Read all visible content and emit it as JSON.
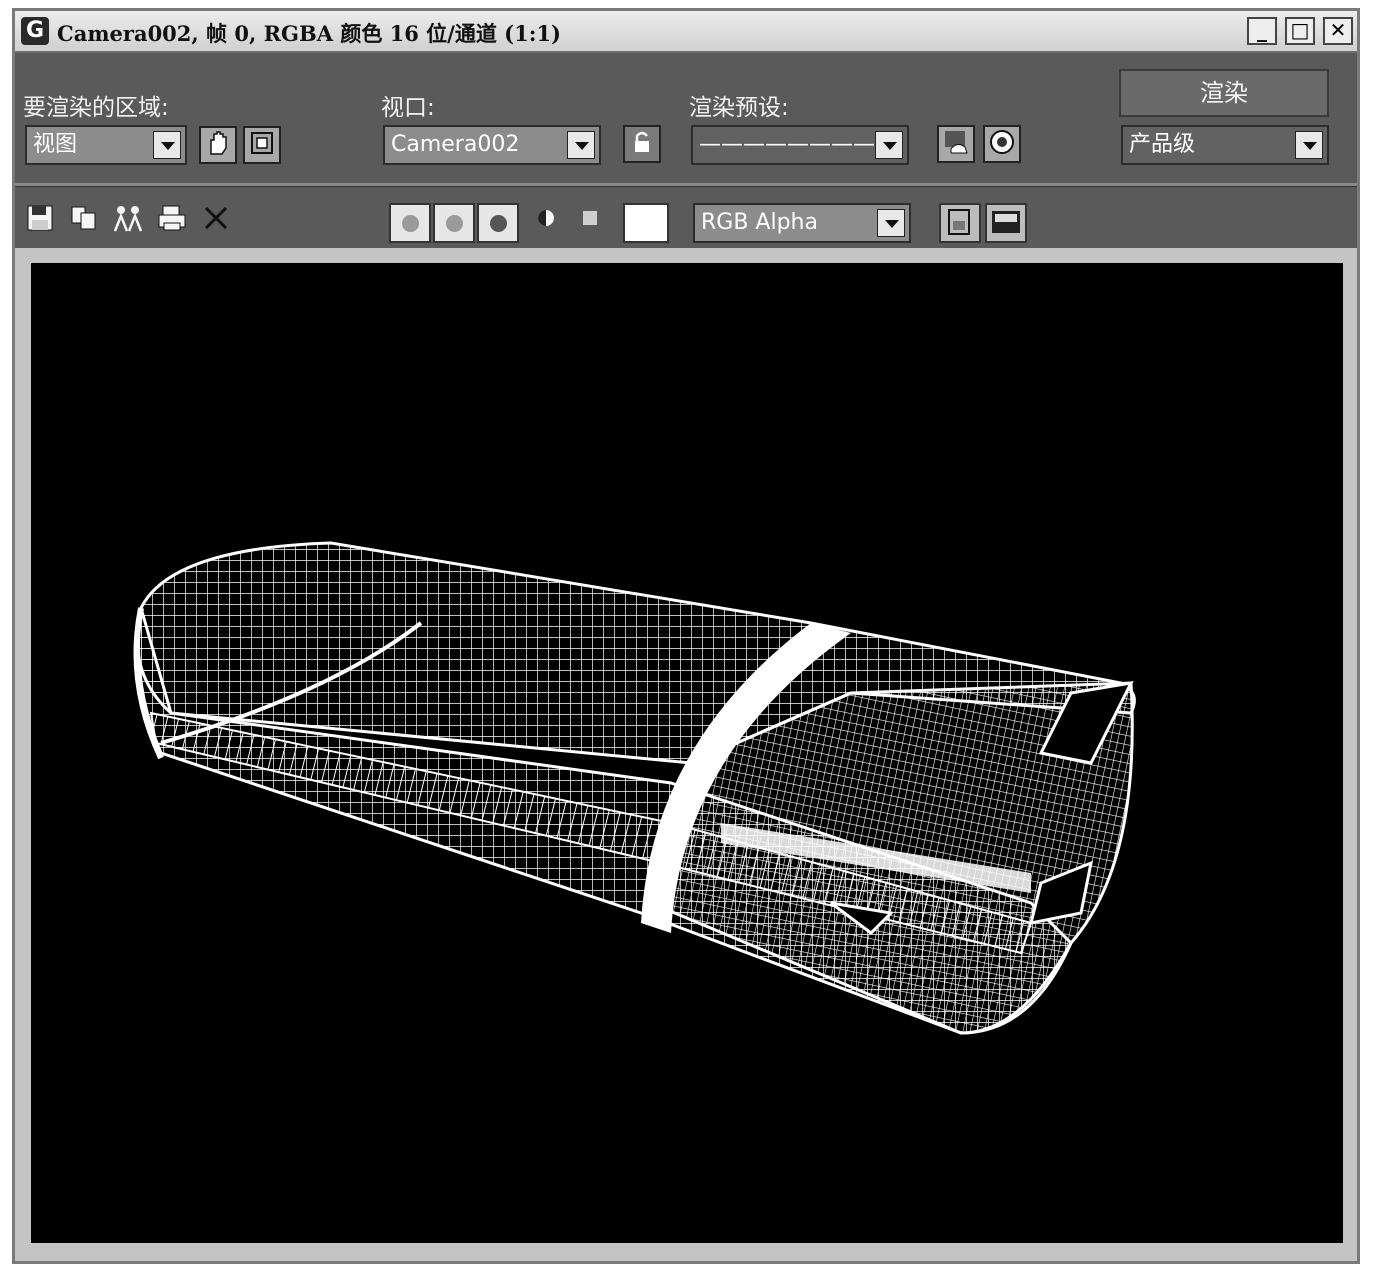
{
  "window": {
    "title": "Camera002, 帧 0, RGBA 颜色 16 位/通道 (1:1)",
    "app_icon_glyph": "G",
    "minimize_glyph": "_",
    "maximize_glyph": "□",
    "close_glyph": "✕"
  },
  "area_to_render": {
    "label": "要渲染的区域:",
    "value": "视图"
  },
  "viewport_select": {
    "label": "视口:",
    "value": "Camera002"
  },
  "render_preset": {
    "label": "渲染预设:",
    "value": "————————"
  },
  "render_button": {
    "label": "渲染"
  },
  "render_level": {
    "value": "产品级"
  },
  "channel_display": {
    "value": "RGB Alpha"
  },
  "colors": {
    "panel": "#5a5a5a",
    "viewport_bg": "#000000",
    "wire": "#ffffff"
  },
  "icons": [
    "hand-icon",
    "region-icon",
    "lock-icon",
    "teapot-icon",
    "clone-icon",
    "save-icon",
    "copy-icon",
    "people-icon",
    "print-icon",
    "clear-icon",
    "red-channel-icon",
    "green-channel-icon",
    "blue-channel-icon",
    "alpha-icon",
    "mono-icon",
    "color-swatch-icon",
    "split-a-icon",
    "split-b-icon"
  ]
}
